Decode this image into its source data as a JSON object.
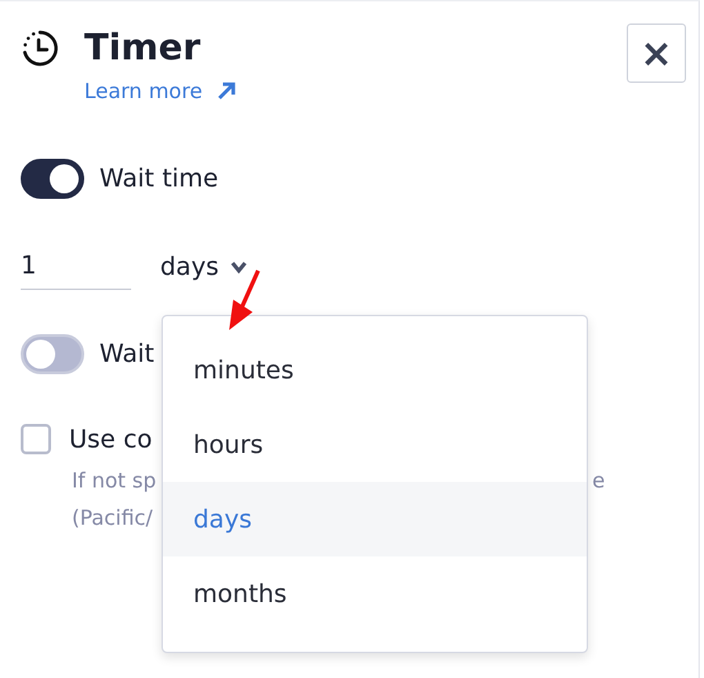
{
  "panel": {
    "title": "Timer",
    "learn_more": "Learn more",
    "close": "×"
  },
  "wait_time": {
    "label": "Wait time",
    "on": true,
    "amount": "1",
    "unit": "days",
    "unit_open": true
  },
  "wait_until": {
    "label": "Wait",
    "on": false
  },
  "custom_timezone": {
    "label": "Use co",
    "checked": false,
    "hint_lines": [
      "If not sp",
      "(Pacific/"
    ],
    "hint_tail": "e"
  },
  "unit_menu": [
    {
      "label": "minutes",
      "selected": false
    },
    {
      "label": "hours",
      "selected": false
    },
    {
      "label": "days",
      "selected": true
    },
    {
      "label": "months",
      "selected": false
    }
  ]
}
